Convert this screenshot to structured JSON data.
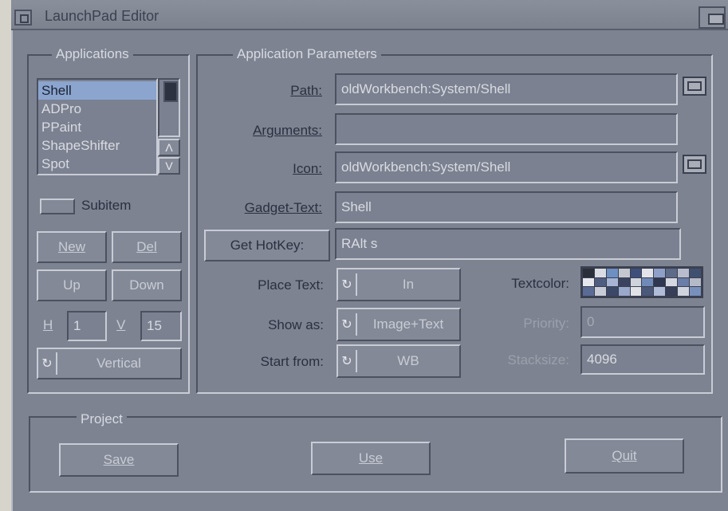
{
  "window": {
    "title": "LaunchPad Editor"
  },
  "applications": {
    "group_title": "Applications",
    "items": [
      "Shell",
      "ADPro",
      "PPaint",
      "ShapeShifter",
      "Spot"
    ],
    "selected": "Shell",
    "scroll_up": "Λ",
    "scroll_down": "V",
    "subitem_label": "Subitem",
    "new_label": "New",
    "del_label": "Del",
    "up_label": "Up",
    "down_label": "Down",
    "h_label": "H",
    "h_value": "1",
    "v_label": "V",
    "v_value": "15",
    "layout_value": "Vertical"
  },
  "params": {
    "group_title": "Application Parameters",
    "path_label": "Path:",
    "path_value": "oldWorkbench:System/Shell",
    "arguments_label": "Arguments:",
    "arguments_value": "",
    "icon_label": "Icon:",
    "icon_value": "oldWorkbench:System/Shell",
    "gadget_text_label": "Gadget-Text:",
    "gadget_text_value": "Shell",
    "get_hotkey_label": "Get HotKey:",
    "hotkey_value": "RAlt s",
    "place_text_label": "Place Text:",
    "place_text_value": "In",
    "show_as_label": "Show as:",
    "show_as_value": "Image+Text",
    "start_from_label": "Start from:",
    "start_from_value": "WB",
    "textcolor_label": "Textcolor:",
    "priority_label": "Priority:",
    "priority_value": "0",
    "stacksize_label": "Stacksize:",
    "stacksize_value": "4096",
    "palette_colors": [
      "#2b2f3a",
      "#d9dce3",
      "#6d8fc2",
      "#c4c7cf",
      "#3d4f7a",
      "#e2e4ea",
      "#8fa0c8",
      "#5d6a88",
      "#b8bccc",
      "#405070",
      "#e6e8ee",
      "#4f5d80",
      "#a8b4d4",
      "#3a4260",
      "#cfd3dc",
      "#708ab8",
      "#2e3650",
      "#d5d8e0",
      "#6a7ca8",
      "#b4bac8",
      "#5a6c94",
      "#c8ccd8",
      "#3c4868",
      "#9aa8cc",
      "#e0e2e8",
      "#4a587a",
      "#b0bcd8",
      "#363e58",
      "#d0d4de",
      "#7890bc"
    ]
  },
  "project": {
    "group_title": "Project",
    "save_label": "Save",
    "use_label": "Use",
    "quit_label": "Quit"
  }
}
